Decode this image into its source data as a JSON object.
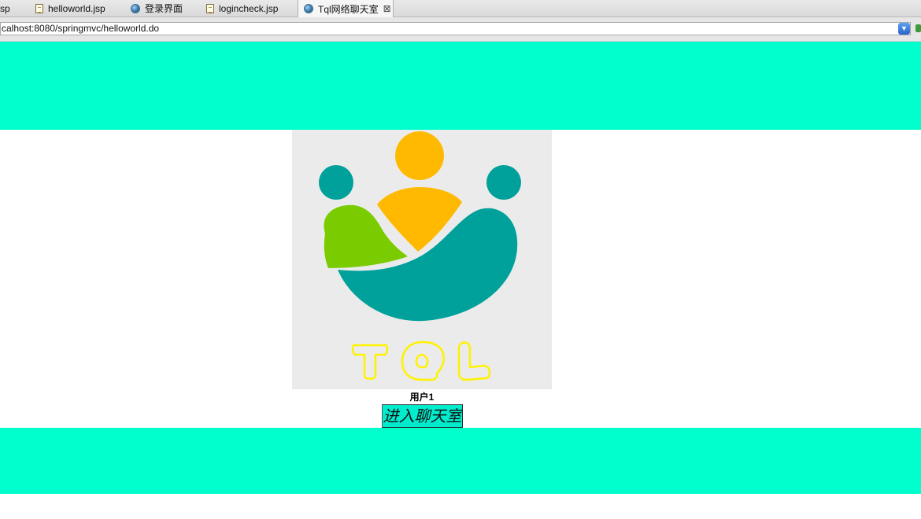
{
  "tabs": [
    {
      "label": "sp",
      "icon": "none"
    },
    {
      "label": "helloworld.jsp",
      "icon": "jsp-file-icon"
    },
    {
      "label": "登录界面",
      "icon": "globe-icon"
    },
    {
      "label": "logincheck.jsp",
      "icon": "jsp-file-icon"
    },
    {
      "label": "Tql网络聊天室",
      "icon": "globe-icon",
      "active": true
    }
  ],
  "address_bar": {
    "url": "calhost:8080/springmvc/helloworld.do"
  },
  "page": {
    "logo": {
      "text": "TQL",
      "colors": {
        "background": "#ebebeb",
        "teal": "#00a19a",
        "amber": "#ffb900",
        "green": "#7acc00",
        "outline_text": "#fff200"
      }
    },
    "username": "用户1",
    "enter_button_label": "进入聊天室",
    "colors": {
      "band": "#00ffcc",
      "button": "#00eccc"
    }
  }
}
